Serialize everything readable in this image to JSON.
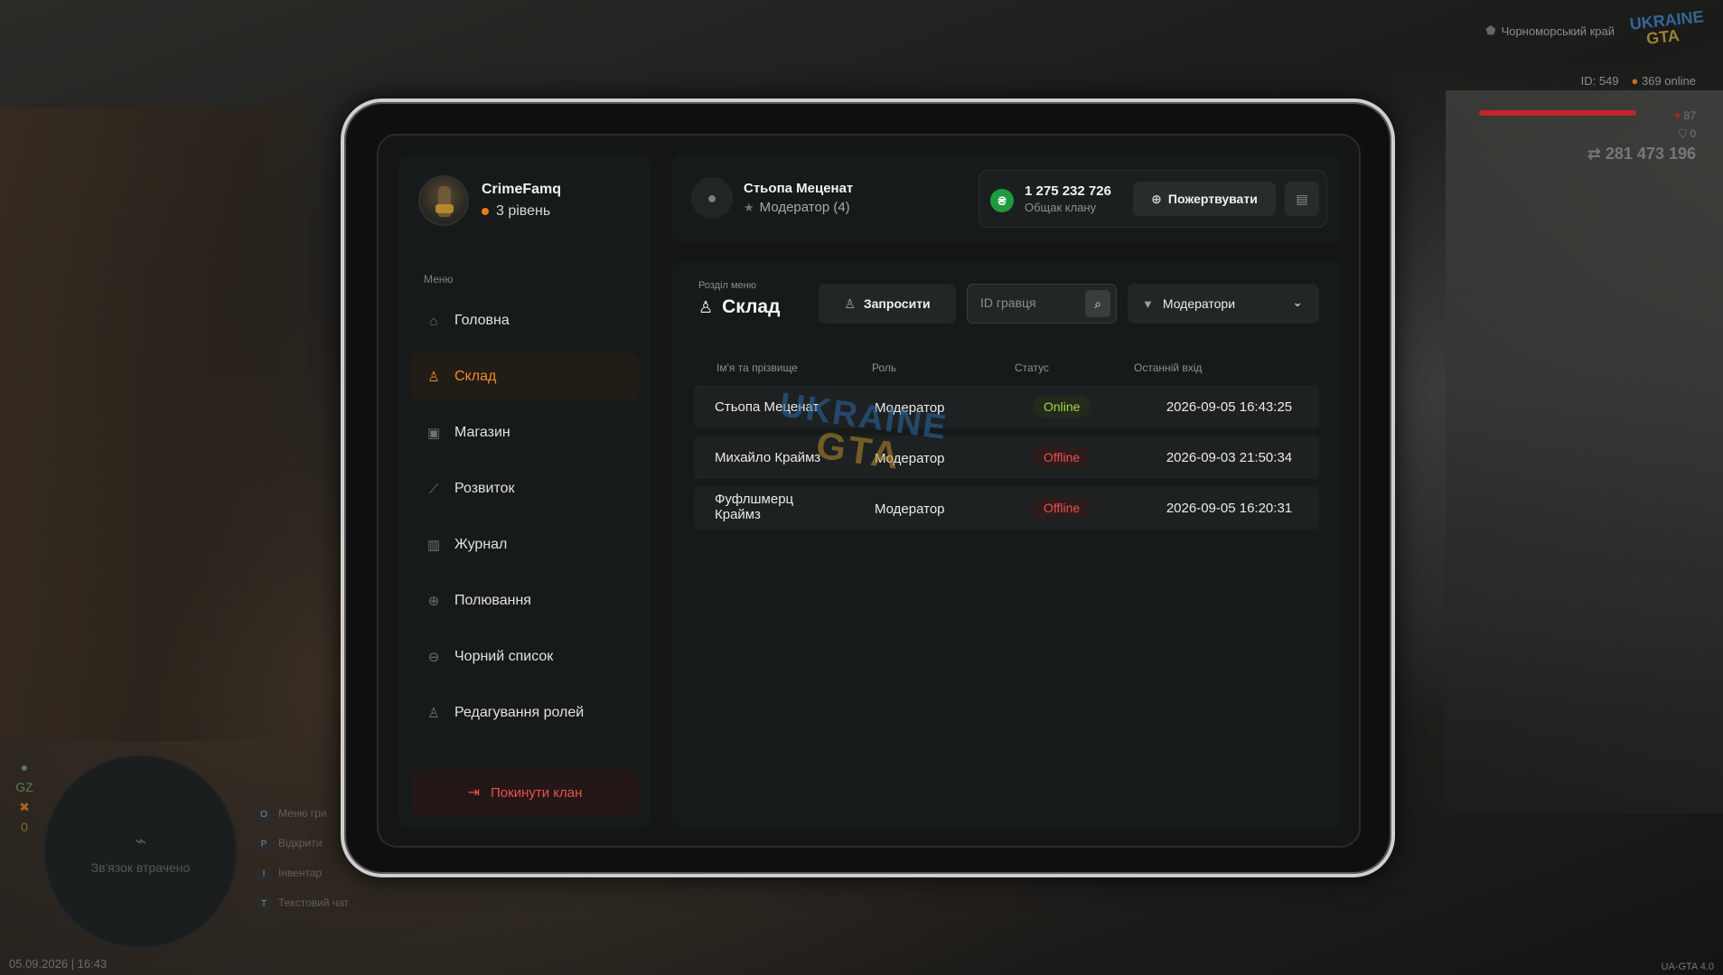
{
  "hud": {
    "region": "Чорноморський край",
    "logo_top": "UKRAINE",
    "logo_bottom": "GTA",
    "player_id": "ID: 549",
    "online": "369 online",
    "health_value": "87",
    "armor_value": "0",
    "health_fraction": 0.87,
    "armor_fraction": 0.0,
    "money": "281 473 196",
    "minimap_status": "Зв'язок втрачено",
    "side_labels": [
      "GZ",
      "0"
    ],
    "keys": [
      {
        "key": "O",
        "label": "Меню гри"
      },
      {
        "key": "P",
        "label": "Відкрити"
      },
      {
        "key": "I",
        "label": "Інвентар"
      },
      {
        "key": "T",
        "label": "Текстовий чат"
      }
    ],
    "datetime": "05.09.2026 | 16:43",
    "version": "UA-GTA 4.0",
    "colors": {
      "health": "#c0262c",
      "armor": "#8a8a8a"
    }
  },
  "profile": {
    "clan_name": "CrimeFamq",
    "level": "3 рівень",
    "level_dot_color": "#e87a1e"
  },
  "sidebar": {
    "caption": "Меню",
    "items": [
      {
        "label": "Головна",
        "icon": "home-icon"
      },
      {
        "label": "Склад",
        "icon": "members-icon",
        "active": true
      },
      {
        "label": "Магазин",
        "icon": "shop-icon"
      },
      {
        "label": "Розвиток",
        "icon": "chart-icon"
      },
      {
        "label": "Журнал",
        "icon": "journal-icon"
      },
      {
        "label": "Полювання",
        "icon": "crosshair-icon"
      },
      {
        "label": "Чорний список",
        "icon": "blacklist-icon"
      },
      {
        "label": "Редагування ролей",
        "icon": "role-edit-icon"
      }
    ],
    "leave_label": "Покинути клан",
    "accent_color": "#f08a2c"
  },
  "header": {
    "user_name": "Стьопа Меценат",
    "user_role": "Модератор (4)",
    "bank_amount": "1 275 232 726",
    "bank_caption": "Общак клану",
    "bank_currency_symbol": "₴",
    "donate_label": "Пожертвувати"
  },
  "main": {
    "section_caption": "Розділ меню",
    "section_title": "Склад",
    "invite_label": "Запросити",
    "search_placeholder": "ID гравця",
    "filter_value": "Модератори",
    "columns": [
      "Ім'я та прізвище",
      "Роль",
      "Статус",
      "Останній вхід"
    ],
    "rows": [
      {
        "name": "Стьопа Меценат",
        "role": "Модератор",
        "status": "Online",
        "last_login": "2026-09-05 16:43:25"
      },
      {
        "name": "Михайло Краймз",
        "role": "Модератор",
        "status": "Offline",
        "last_login": "2026-09-03 21:50:34"
      },
      {
        "name": "Фуфлшмерц Краймз",
        "role": "Модератор",
        "status": "Offline",
        "last_login": "2026-09-05 16:20:31"
      }
    ],
    "watermark_top": "UKRAINE",
    "watermark_bottom": "GTA"
  }
}
